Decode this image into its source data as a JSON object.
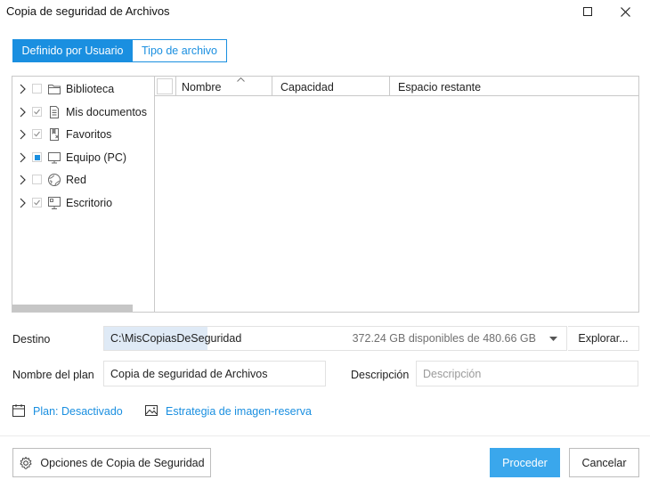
{
  "window": {
    "title": "Copia de seguridad de Archivos"
  },
  "tabs": [
    {
      "label": "Definido por Usuario",
      "active": true
    },
    {
      "label": "Tipo de archivo",
      "active": false
    }
  ],
  "tree": {
    "items": [
      {
        "label": "Biblioteca",
        "icon": "folder-icon",
        "check": "unchecked"
      },
      {
        "label": "Mis documentos",
        "icon": "document-icon",
        "check": "checked"
      },
      {
        "label": "Favoritos",
        "icon": "favorites-icon",
        "check": "checked"
      },
      {
        "label": "Equipo (PC)",
        "icon": "computer-icon",
        "check": "partial"
      },
      {
        "label": "Red",
        "icon": "network-icon",
        "check": "unchecked"
      },
      {
        "label": "Escritorio",
        "icon": "desktop-icon",
        "check": "checked"
      }
    ]
  },
  "list": {
    "columns": [
      "Nombre",
      "Capacidad",
      "Espacio restante"
    ]
  },
  "destination": {
    "label": "Destino",
    "path": "C:\\MisCopiasDeSeguridad",
    "space": "372.24 GB disponibles de 480.66 GB",
    "browse_label": "Explorar..."
  },
  "plan": {
    "name_label": "Nombre del plan",
    "name_value": "Copia de seguridad de Archivos",
    "description_label": "Descripción",
    "description_placeholder": "Descripción"
  },
  "links": {
    "schedule": "Plan: Desactivado",
    "image_strategy": "Estrategia de imagen-reserva"
  },
  "footer": {
    "options_label": "Opciones de Copia de Seguridad",
    "proceed_label": "Proceder",
    "cancel_label": "Cancelar"
  },
  "colors": {
    "accent": "#1a8fe0",
    "primary_button": "#3aa7ec",
    "border": "#c9c9c9"
  }
}
